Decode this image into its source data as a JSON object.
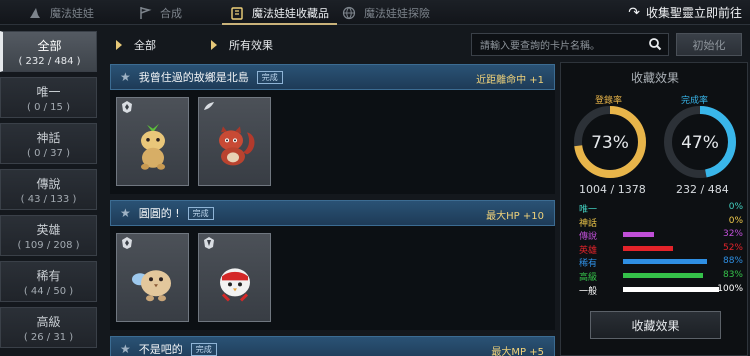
{
  "tabs": [
    {
      "label": "魔法娃娃",
      "icon": "hat-icon"
    },
    {
      "label": "合成",
      "icon": "flag-icon"
    },
    {
      "label": "魔法娃娃收藏品",
      "icon": "book-icon"
    },
    {
      "label": "魔法娃娃探險",
      "icon": "globe-icon"
    }
  ],
  "collect_link": "收集聖靈立即前往",
  "sidebar": [
    {
      "name": "全部",
      "count": "( 232 / 484 )"
    },
    {
      "name": "唯一",
      "count": "( 0 / 15 )"
    },
    {
      "name": "神話",
      "count": "( 0 / 37 )"
    },
    {
      "name": "傳說",
      "count": "( 43 / 133 )"
    },
    {
      "name": "英雄",
      "count": "( 109 / 208 )"
    },
    {
      "name": "稀有",
      "count": "( 44 / 50 )"
    },
    {
      "name": "高級",
      "count": "( 26 / 31 )"
    }
  ],
  "filters": {
    "category": "全部",
    "effect": "所有效果"
  },
  "search": {
    "placeholder": "請輸入要查詢的卡片名稱。"
  },
  "reset_label": "初始化",
  "groups": [
    {
      "title": "我曾住過的故鄉是北島",
      "badge": "完成",
      "effect": "近距離命中 +1",
      "cards": [
        "sprout-doll",
        "red-squirrel-doll"
      ]
    },
    {
      "title": "圓圓的 !",
      "badge": "完成",
      "effect": "最大HP +10",
      "cards": [
        "blue-bird-doll",
        "white-bird-doll"
      ]
    },
    {
      "title": "不是吧的",
      "badge": "完成",
      "effect": "最大MP +5",
      "cards": []
    }
  ],
  "stats": {
    "title": "收藏效果",
    "registration": {
      "label": "登錄率",
      "percent": 73,
      "text": "73%",
      "value": "1004 / 1378",
      "color": "#e8b54a"
    },
    "completion": {
      "label": "完成率",
      "percent": 47,
      "text": "47%",
      "value": "232 / 484",
      "color": "#39b6ea"
    },
    "rows": [
      {
        "label": "唯一",
        "pct": "0%",
        "fill": 0,
        "color": "#42d0c0",
        "text_color": "#42d0c0"
      },
      {
        "label": "神話",
        "pct": "0%",
        "fill": 0,
        "color": "#f0c94a",
        "text_color": "#f0c94a"
      },
      {
        "label": "傳說",
        "pct": "32%",
        "fill": 32,
        "color": "#c04fd8",
        "text_color": "#c04fd8"
      },
      {
        "label": "英雄",
        "pct": "52%",
        "fill": 52,
        "color": "#e3232a",
        "text_color": "#e3232a"
      },
      {
        "label": "稀有",
        "pct": "88%",
        "fill": 88,
        "color": "#2f8fe3",
        "text_color": "#2f8fe3"
      },
      {
        "label": "高級",
        "pct": "83%",
        "fill": 83,
        "color": "#35c24a",
        "text_color": "#35c24a"
      },
      {
        "label": "一般",
        "pct": "100%",
        "fill": 100,
        "color": "#ffffff",
        "text_color": "#ffffff"
      }
    ],
    "button_label": "收藏效果"
  }
}
